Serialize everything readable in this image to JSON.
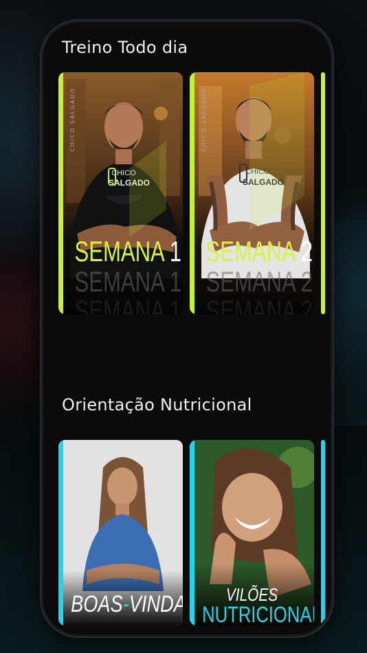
{
  "sections": [
    {
      "title": "Treino Todo dia",
      "accent": "#c7f233",
      "cards": [
        {
          "word": "SEMANA",
          "number": "1",
          "tag": "CHICO SALGADO",
          "shirt_brand": "CHICO",
          "shirt_brand2": "SALGADO"
        },
        {
          "word": "SEMANA",
          "number": "2",
          "tag": "CHICO SALGADO",
          "shirt_brand": "CHICO",
          "shirt_brand2": "SALGADO"
        }
      ]
    },
    {
      "title": "Orientação Nutricional",
      "accent": "#22d5ec",
      "cards": [
        {
          "label_a": "BOAS",
          "label_sep": "-",
          "label_b": "VINDAS"
        },
        {
          "line1": "VILÕES",
          "line2": "NUTRICIONAIS"
        }
      ]
    }
  ]
}
